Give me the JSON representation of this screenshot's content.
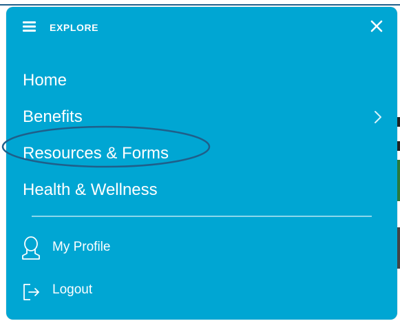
{
  "menu": {
    "title": "EXPLORE",
    "icons": {
      "menu": "hamburger-icon",
      "close": "close-icon"
    },
    "colors": {
      "panel_background": "#00a6d3",
      "text": "#ffffff",
      "highlight_annotation": "#1f5f8a"
    },
    "nav_items": [
      {
        "label": "Home",
        "has_submenu": false
      },
      {
        "label": "Benefits",
        "has_submenu": true,
        "submenu_icon": "chevron-right-icon"
      },
      {
        "label": "Resources & Forms",
        "has_submenu": false,
        "annotated": true
      },
      {
        "label": "Health & Wellness",
        "has_submenu": false
      }
    ],
    "account_items": [
      {
        "label": "My Profile",
        "icon": "user-profile-icon"
      },
      {
        "label": "Logout",
        "icon": "logout-icon"
      }
    ]
  }
}
